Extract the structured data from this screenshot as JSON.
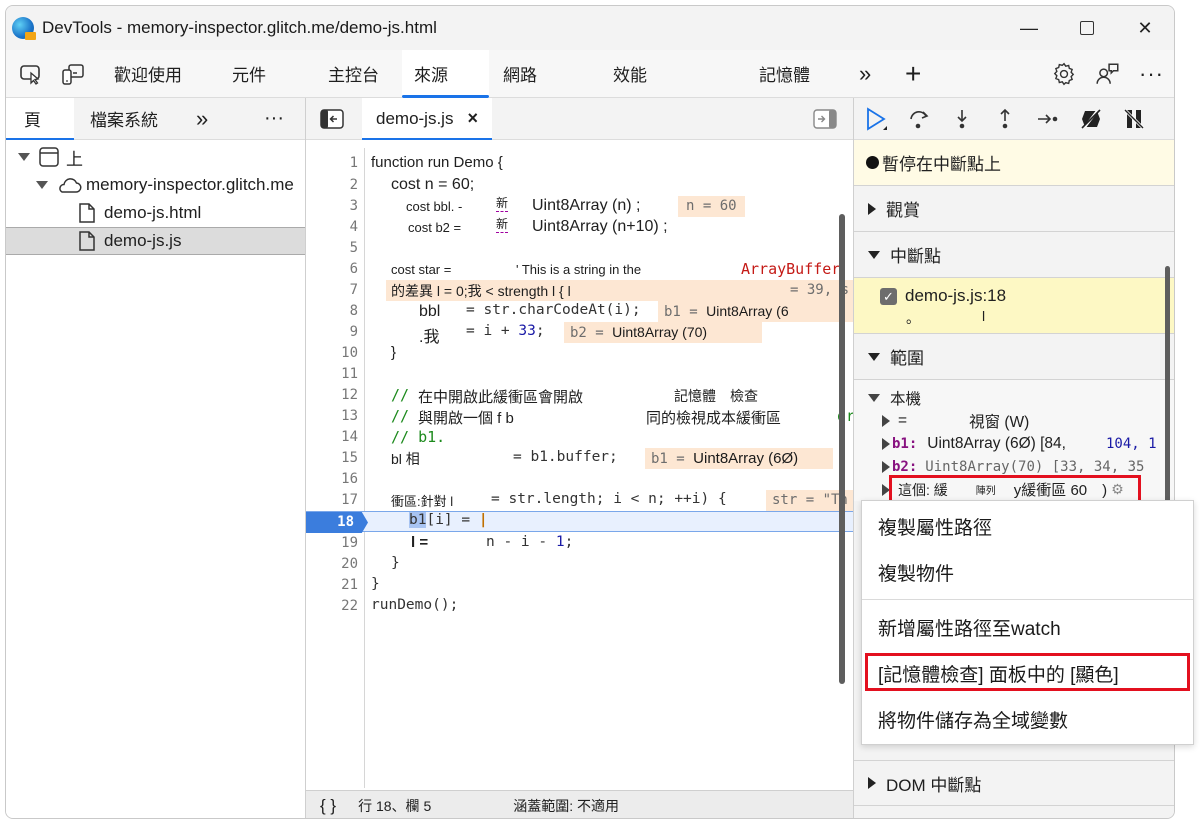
{
  "window": {
    "title": "DevTools - memory-inspector.glitch.me/demo-js.html",
    "controls": {
      "minimize": "—",
      "maximize": "☐",
      "close": "✕"
    }
  },
  "main_tabs": {
    "items": [
      {
        "label": "歡迎使用",
        "active": false
      },
      {
        "label": "元件",
        "active": false
      },
      {
        "label": "主控台",
        "active": false
      },
      {
        "label": "來源",
        "active": true
      },
      {
        "label": "網路",
        "active": false
      },
      {
        "label": "效能",
        "active": false
      },
      {
        "label": "記憶體",
        "active": false
      }
    ],
    "more": "»",
    "add": "+",
    "accent": "#1a73e8"
  },
  "navigator": {
    "tabs": [
      {
        "label": "頁",
        "active": true
      },
      {
        "label": "檔案系統",
        "active": false
      }
    ],
    "more": "»",
    "menu": "···",
    "tree": [
      {
        "label": "上",
        "icon": "frame-icon",
        "level": 0,
        "expanded": true
      },
      {
        "label": "memory-inspector.glitch.me",
        "icon": "cloud-icon",
        "level": 1,
        "expanded": true
      },
      {
        "label": "demo-js.html",
        "icon": "file-icon",
        "level": 2,
        "selected": false
      },
      {
        "label": "demo-js.js",
        "icon": "file-icon",
        "level": 2,
        "selected": true
      }
    ]
  },
  "editor": {
    "tab": {
      "label": "demo-js.js",
      "close": "×"
    },
    "lines": [
      {
        "n": "1",
        "text": "function run Demo {"
      },
      {
        "n": "2",
        "text": "cost n = 60;"
      },
      {
        "n": "3",
        "text": "cost bbl. -",
        "new": "新",
        "rest": "Uint8Array (n) ;",
        "inline": "n = 60"
      },
      {
        "n": "4",
        "text": "cost b2 =",
        "new": "新",
        "rest": "Uint8Array (n+10) ;"
      },
      {
        "n": "5",
        "text": ""
      },
      {
        "n": "6",
        "text": "cost star =",
        "str": "' This is a string in the",
        "red": "ArrayBuffer"
      },
      {
        "n": "7",
        "text": "的差異 l = 0;我 < strength l { l",
        "inline": "= 39, s"
      },
      {
        "n": "8",
        "text": "bbl",
        "code": "= str.charCodeAt(i);",
        "inline_key": "b1 =",
        "inline_val": "Uint8Array (6"
      },
      {
        "n": "9",
        "text": ".我",
        "code": "= i + ",
        "num": "33",
        "end": ";",
        "inline_key": "b2 =",
        "inline_val": "Uint8Array (70)"
      },
      {
        "n": "10",
        "text": "}"
      },
      {
        "n": "11",
        "text": ""
      },
      {
        "n": "12",
        "cmt": "//",
        "text": "在中開啟此緩衝區會開啟",
        "extra": "記憶體　檢查"
      },
      {
        "n": "13",
        "cmt": "//",
        "text": "與開啟一個 f b",
        "extra": "同的檢視成本緩衝區",
        "tail": "or"
      },
      {
        "n": "14",
        "cmt": "// b1."
      },
      {
        "n": "15",
        "text": "bl 相",
        "code": "= b1.buffer;",
        "inline_key": "b1 =",
        "inline_val": "Uint8Array (6Ø)"
      },
      {
        "n": "16",
        "text": ""
      },
      {
        "n": "17",
        "text": "衝區:針對 l",
        "code": "= str.length; i < n; ++i) {",
        "inline": "str = \"Th"
      },
      {
        "n": "18",
        "code": "b1[i] = |"
      },
      {
        "n": "19",
        "text": "l =",
        "code": "n - i - ",
        "num": "1",
        "end": ";"
      },
      {
        "n": "20",
        "text": "}"
      },
      {
        "n": "21",
        "text": "}"
      },
      {
        "n": "22",
        "code": "runDemo();"
      }
    ],
    "current_line": "18"
  },
  "statusbar": {
    "format_icon": "{ }",
    "position": "行 18、欄 5",
    "coverage": "涵蓋範圍: 不適用"
  },
  "debugger": {
    "paused_text": "暫停在中斷點上",
    "sections": {
      "watch": "觀賞",
      "breakpoints": "中斷點",
      "scope": "範圍",
      "dom_breakpoints": "DOM 中斷點"
    },
    "breakpoint": {
      "label": "demo-js.js:18",
      "checked": true,
      "detail_a": "。",
      "detail_b": "l"
    },
    "scope": {
      "local": "本機",
      "rows": [
        {
          "key": "=",
          "value": "視窗 (W)"
        },
        {
          "key": "b1:",
          "value": "Uint8Array (6Ø) [84,",
          "extra": "104, 1"
        },
        {
          "key": "b2:",
          "value": "Uint8Array(70) [33, 34, 35"
        },
        {
          "key": "這個: 緩",
          "value": "陣列",
          "extra": "y緩衝區 60　)"
        }
      ]
    }
  },
  "context_menu": {
    "items": [
      {
        "label": "複製屬性路徑"
      },
      {
        "label": "複製物件"
      },
      {
        "label": "新增屬性路徑至watch"
      },
      {
        "label": "[記憶體檢查] 面板中的 [顯色]",
        "highlighted": true
      },
      {
        "label": "將物件儲存為全域變數"
      }
    ]
  },
  "colors": {
    "highlight_box": "#e3101f",
    "inline_value_bg": "#fde7d3",
    "paused_bg": "#fffbe5",
    "breakpoint_bg": "#fdf8c4",
    "current_line_marker": "#3b7ddd"
  }
}
